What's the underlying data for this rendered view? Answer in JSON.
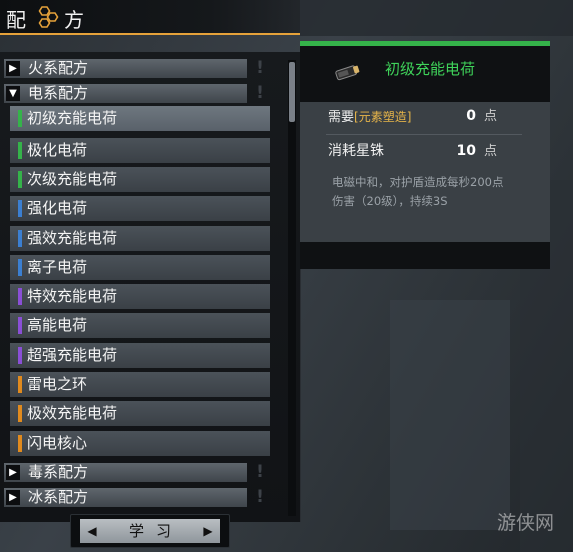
{
  "title": {
    "left": "配",
    "right": "方",
    "icon": "hexagon-cluster-icon"
  },
  "categories": [
    {
      "label": "火系配方",
      "expanded": false
    },
    {
      "label": "电系配方",
      "expanded": true
    },
    {
      "label": "毒系配方",
      "expanded": false
    },
    {
      "label": "冰系配方",
      "expanded": false
    }
  ],
  "recipes": [
    {
      "label": "初级充能电荷",
      "tier_color": "#35b34a",
      "selected": true
    },
    {
      "label": "极化电荷",
      "tier_color": "#35b34a"
    },
    {
      "label": "次级充能电荷",
      "tier_color": "#35b34a"
    },
    {
      "label": "强化电荷",
      "tier_color": "#3b7fd1"
    },
    {
      "label": "强效充能电荷",
      "tier_color": "#3b7fd1"
    },
    {
      "label": "离子电荷",
      "tier_color": "#3b7fd1"
    },
    {
      "label": "特效充能电荷",
      "tier_color": "#8a4fd6"
    },
    {
      "label": "高能电荷",
      "tier_color": "#8a4fd6"
    },
    {
      "label": "超强充能电荷",
      "tier_color": "#8a4fd6"
    },
    {
      "label": "雷电之环",
      "tier_color": "#e08a1e"
    },
    {
      "label": "极效充能电荷",
      "tier_color": "#e08a1e"
    },
    {
      "label": "闪电核心",
      "tier_color": "#e08a1e"
    }
  ],
  "learn": {
    "label": "学习",
    "prev_icon": "left-arrow-icon",
    "next_icon": "right-arrow-icon"
  },
  "detail": {
    "title": "初级充能电荷",
    "icon": "energy-cell-icon",
    "requirement_label": "需要",
    "requirement_tag": "[元素塑造]",
    "requirement_value": "0",
    "requirement_unit": "点",
    "cost_label": "消耗星铢",
    "cost_value": "10",
    "cost_unit": "点",
    "description_line1": "电磁中和，对护盾造成每秒200点",
    "description_line2": "伤害（20级），持续3S"
  },
  "watermark": "游侠网",
  "colors": {
    "accent_gold": "#e6a23a",
    "detail_green": "#3fd35a",
    "tag_yellow": "#e7b54a"
  }
}
